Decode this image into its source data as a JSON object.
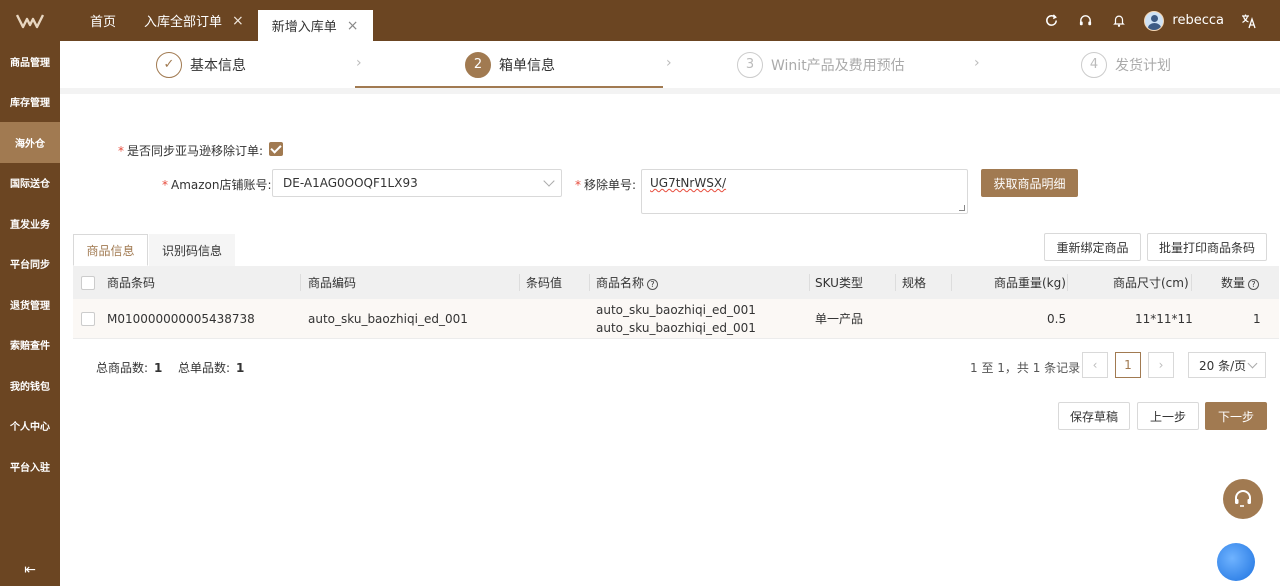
{
  "topbar": {
    "tabs": [
      {
        "label": "首页",
        "closable": false
      },
      {
        "label": "入库全部订单",
        "closable": true
      },
      {
        "label": "新增入库单",
        "closable": true,
        "active": true
      }
    ],
    "close_glyph": "×",
    "username": "rebecca"
  },
  "sidebar": {
    "items": [
      "商品管理",
      "库存管理",
      "海外仓",
      "国际送仓",
      "直发业务",
      "平台同步",
      "退货管理",
      "索赔查件",
      "我的钱包",
      "个人中心",
      "平台入驻"
    ],
    "active_index": 2,
    "collapse_glyph": "⇤"
  },
  "steps": [
    {
      "number": "✓",
      "label": "基本信息",
      "state": "done"
    },
    {
      "number": "2",
      "label": "箱单信息",
      "state": "current"
    },
    {
      "number": "3",
      "label": "Winit产品及费用预估",
      "state": "pending"
    },
    {
      "number": "4",
      "label": "发货计划",
      "state": "pending"
    }
  ],
  "form": {
    "sync_label": "是否同步亚马逊移除订单:",
    "sync_checked": true,
    "store_label": "Amazon店铺账号:",
    "store_value": "DE-A1AG0OOQF1LX93",
    "removal_label": "移除单号:",
    "removal_value": "UG7tNrWSX/",
    "fetch_button": "获取商品明细"
  },
  "info_tabs": [
    "商品信息",
    "识别码信息"
  ],
  "actions": {
    "rebind": "重新绑定商品",
    "batch_print": "批量打印商品条码"
  },
  "table": {
    "headers": {
      "barcode": "商品条码",
      "code": "商品编码",
      "barcode_value": "条码值",
      "name": "商品名称",
      "sku_type": "SKU类型",
      "spec": "规格",
      "weight": "商品重量(kg)",
      "size": "商品尺寸(cm)",
      "qty": "数量"
    },
    "rows": [
      {
        "barcode": "M010000000005438738",
        "code": "auto_sku_baozhiqi_ed_001",
        "barcode_value": "",
        "name_line1": "auto_sku_baozhiqi_ed_001",
        "name_line2": "auto_sku_baozhiqi_ed_001",
        "sku_type": "单一产品",
        "spec": "",
        "weight": "0.5",
        "size": "11*11*11",
        "qty": "1"
      }
    ]
  },
  "totals": {
    "goods_label": "总商品数:",
    "goods_value": "1",
    "single_label": "总单品数:",
    "single_value": "1"
  },
  "pagination": {
    "summary": "1 至 1，共 1 条记录",
    "prev": "‹",
    "current": "1",
    "next": "›",
    "page_size": "20 条/页"
  },
  "footer_buttons": {
    "save_draft": "保存草稿",
    "prev_step": "上一步",
    "next_step": "下一步"
  },
  "colors": {
    "brand": "#6b4522",
    "accent": "#a17a51"
  }
}
